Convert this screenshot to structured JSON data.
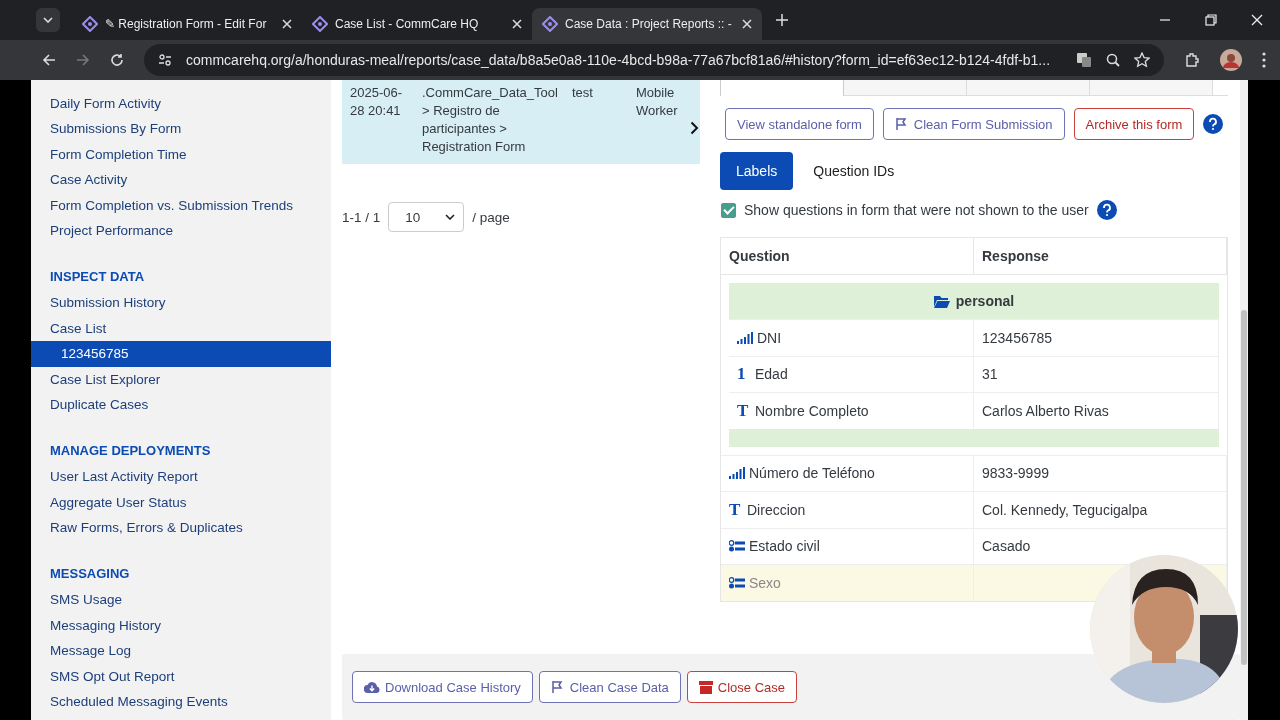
{
  "browser": {
    "tabs": [
      {
        "title": "✎ Registration Form - Edit For",
        "selected": false
      },
      {
        "title": "Case List - CommCare HQ",
        "selected": false
      },
      {
        "title": "Case Data : Project Reports :: -",
        "selected": true
      }
    ],
    "url": "commcarehq.org/a/honduras-meal/reports/case_data/b8a5e0a8-110e-4bcd-b98a-77a67bcf81a6/#history?form_id=ef63ec12-b124-4fdf-b1..."
  },
  "sidebar": {
    "items": [
      {
        "label": "Daily Form Activity",
        "kind": "link",
        "selected": false
      },
      {
        "label": "Submissions By Form",
        "kind": "link",
        "selected": false
      },
      {
        "label": "Form Completion Time",
        "kind": "link",
        "selected": false
      },
      {
        "label": "Case Activity",
        "kind": "link",
        "selected": false
      },
      {
        "label": "Form Completion vs. Submission Trends",
        "kind": "link",
        "selected": false
      },
      {
        "label": "Project Performance",
        "kind": "link",
        "selected": false
      },
      {
        "label": "INSPECT DATA",
        "kind": "header"
      },
      {
        "label": "Submission History",
        "kind": "link",
        "selected": false
      },
      {
        "label": "Case List",
        "kind": "link",
        "selected": false,
        "children": [
          {
            "label": "123456785",
            "kind": "link",
            "selected": true
          }
        ]
      },
      {
        "label": "Case List Explorer",
        "kind": "link",
        "selected": false
      },
      {
        "label": "Duplicate Cases",
        "kind": "link",
        "selected": false
      },
      {
        "label": "MANAGE DEPLOYMENTS",
        "kind": "header"
      },
      {
        "label": "User Last Activity Report",
        "kind": "link",
        "selected": false
      },
      {
        "label": "Aggregate User Status",
        "kind": "link",
        "selected": false
      },
      {
        "label": "Raw Forms, Errors & Duplicates",
        "kind": "link",
        "selected": false
      },
      {
        "label": "MESSAGING",
        "kind": "header"
      },
      {
        "label": "SMS Usage",
        "kind": "link",
        "selected": false
      },
      {
        "label": "Messaging History",
        "kind": "link",
        "selected": false
      },
      {
        "label": "Message Log",
        "kind": "link",
        "selected": false
      },
      {
        "label": "SMS Opt Out Report",
        "kind": "link",
        "selected": false
      },
      {
        "label": "Scheduled Messaging Events",
        "kind": "link",
        "selected": false
      }
    ]
  },
  "history": {
    "row": {
      "date": "2025-06-28 20:41",
      "form": ".CommCare_Data_Tool > Registro de participantes > Registration Form",
      "user": "test",
      "user_type": "Mobile Worker",
      "selected": true
    },
    "pagination": {
      "range": "1-1 / 1",
      "page_size": "10",
      "suffix": "/ page"
    }
  },
  "form_tabs": [
    {
      "selected": true
    },
    {
      "selected": false
    },
    {
      "selected": false
    },
    {
      "selected": false
    }
  ],
  "form_actions": [
    {
      "label": "View standalone form",
      "kind": "plain"
    },
    {
      "label": "Clean Form Submission",
      "kind": "clean"
    },
    {
      "label": "Archive this form",
      "kind": "danger"
    }
  ],
  "view_tabs": [
    {
      "label": "Labels",
      "selected": true
    },
    {
      "label": "Question IDs",
      "selected": false
    }
  ],
  "show_hidden": {
    "label": "Show questions in form that were not shown to the user",
    "checked": true
  },
  "questions": {
    "columns": [
      "Question",
      "Response"
    ],
    "group": {
      "label": "personal",
      "rows": [
        {
          "question": "DNI",
          "response": "123456785",
          "kind": "phone",
          "hidden": false
        },
        {
          "question": "Edad",
          "response": "31",
          "kind": "int",
          "glyph": "1",
          "hidden": false
        },
        {
          "question": "Nombre Completo",
          "response": "Carlos Alberto Rivas",
          "kind": "text",
          "glyph": "T",
          "hidden": false
        }
      ]
    },
    "rows": [
      {
        "question": "Número de Teléfono",
        "response": "9833-9999",
        "kind": "phone",
        "hidden": false
      },
      {
        "question": "Direccion",
        "response": "Col. Kennedy, Tegucigalpa",
        "kind": "text",
        "glyph": "T",
        "hidden": false
      },
      {
        "question": "Estado civil",
        "response": "Casado",
        "kind": "select",
        "hidden": false
      },
      {
        "question": "Sexo",
        "kind": "select",
        "hidden": true
      }
    ]
  },
  "case_actions": [
    {
      "label": "Download Case History",
      "kind": "download"
    },
    {
      "label": "Clean Case Data",
      "kind": "clean"
    },
    {
      "label": "Close Case",
      "kind": "danger"
    }
  ]
}
